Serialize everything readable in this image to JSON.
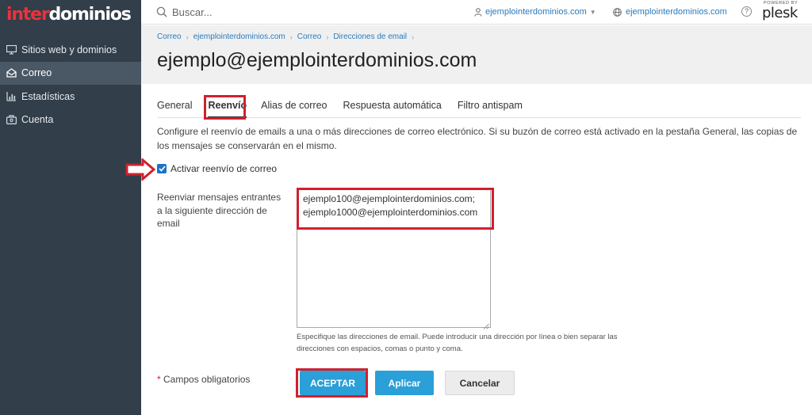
{
  "brand": {
    "logo_part1": "inter",
    "logo_part2": "dominios",
    "powered_by": "POWERED BY",
    "plesk": "plesk"
  },
  "sidebar": {
    "items": [
      {
        "label": "Sitios web y dominios",
        "icon": "monitor-icon",
        "active": false
      },
      {
        "label": "Correo",
        "icon": "mail-icon",
        "active": true
      },
      {
        "label": "Estadísticas",
        "icon": "bar-chart-icon",
        "active": false
      },
      {
        "label": "Cuenta",
        "icon": "account-icon",
        "active": false
      }
    ]
  },
  "topbar": {
    "search_placeholder": "Buscar...",
    "user": "ejemplointerdominios.com",
    "site": "ejemplointerdominios.com",
    "help": "?"
  },
  "breadcrumb": {
    "items": [
      "Correo",
      "ejemplointerdominios.com",
      "Correo",
      "Direcciones de email"
    ]
  },
  "page_title": "ejemplo@ejemplointerdominios.com",
  "tabs": [
    {
      "label": "General",
      "active": false
    },
    {
      "label": "Reenvío",
      "active": true
    },
    {
      "label": "Alias de correo",
      "active": false
    },
    {
      "label": "Respuesta automática",
      "active": false
    },
    {
      "label": "Filtro antispam",
      "active": false
    }
  ],
  "description": "Configure el reenvío de emails a una o más direcciones de correo electrónico. Si su buzón de correo está activado en la pestaña General, las copias de los mensajes se conservarán en el mismo.",
  "checkbox": {
    "label": "Activar reenvío de correo",
    "checked": true
  },
  "forward": {
    "label": "Reenviar mensajes entrantes a la siguiente dirección de email",
    "line1": "ejemplo100@ejemplointerdominios.com;",
    "line2": "ejemplo1000@ejemplointerdominios.com",
    "hint": "Especifique las direcciones de email. Puede introducir una dirección por línea o bien separar las direcciones con espacios, comas o punto y coma."
  },
  "form": {
    "required_star": "*",
    "required_text": "Campos obligatorios",
    "ok": "ACEPTAR",
    "apply": "Aplicar",
    "cancel": "Cancelar"
  },
  "colors": {
    "sidebar": "#323e4a",
    "accent": "#2a9fd8",
    "highlight": "#d0202e",
    "link": "#2a7bbd"
  }
}
